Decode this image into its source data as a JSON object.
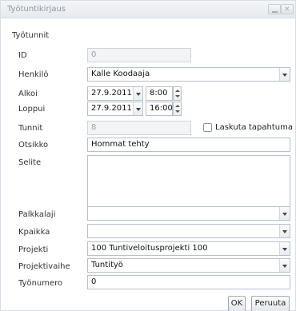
{
  "window": {
    "title": "Työtuntikirjaus"
  },
  "section": {
    "title": "Työtunnit"
  },
  "labels": {
    "id": "ID",
    "henkilo": "Henkilö",
    "alkoi": "Alkoi",
    "loppui": "Loppui",
    "tunnit": "Tunnit",
    "otsikko": "Otsikko",
    "selite": "Selite",
    "palkkalaji": "Palkkalaji",
    "kpaikka": "Kpaikka",
    "projekti": "Projekti",
    "projektivaihe": "Projektivaihe",
    "tyonumero": "Työnumero"
  },
  "values": {
    "id": "0",
    "henkilo": "Kalle Koodaaja",
    "alkoi_date": "27.9.2011",
    "alkoi_time": "8:00",
    "loppui_date": "27.9.2011",
    "loppui_time": "16:00",
    "tunnit": "8",
    "otsikko": "Hommat tehty",
    "selite": "",
    "palkkalaji": "",
    "kpaikka": "",
    "projekti": "100 Tuntiveloitusprojekti 100",
    "projektivaihe": "Tuntityö",
    "tyonumero": "0"
  },
  "checkbox": {
    "label": "Laskuta tapahtuma",
    "checked": false
  },
  "buttons": {
    "ok": "OK",
    "cancel": "Peruuta"
  }
}
